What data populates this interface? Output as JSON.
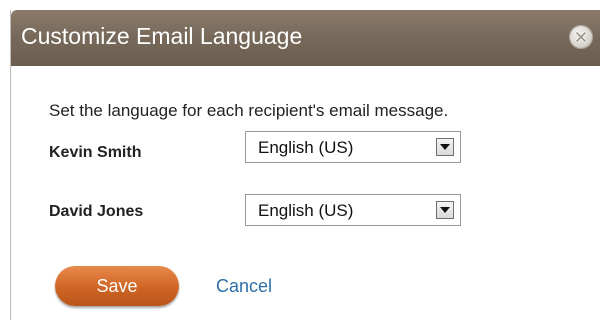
{
  "dialog": {
    "title": "Customize Email Language",
    "close_icon": "close-icon",
    "instruction": "Set the language for each recipient's email message.",
    "recipients": [
      {
        "name": "Kevin Smith",
        "language": "English (US)"
      },
      {
        "name": "David Jones",
        "language": "English (US)"
      }
    ],
    "save_label": "Save",
    "cancel_label": "Cancel"
  },
  "colors": {
    "titlebar": "#77695a",
    "save_button": "#cf6524",
    "link": "#2f6fa8"
  }
}
